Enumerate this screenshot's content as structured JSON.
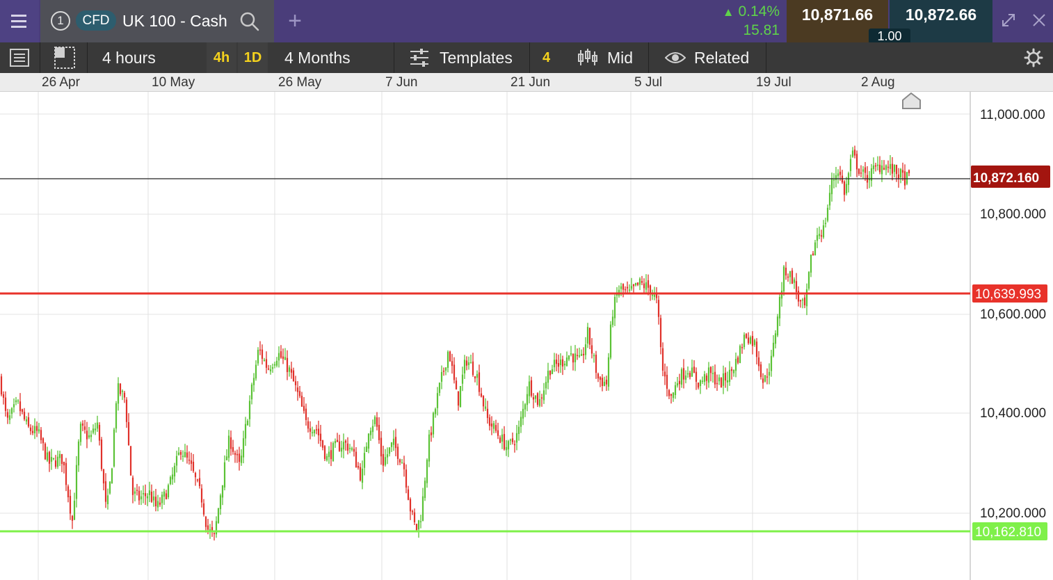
{
  "header": {
    "tab_number": "1",
    "product_badge": "CFD",
    "instrument_name": "UK 100 - Cash",
    "change_percent": "0.14%",
    "change_points": "15.81",
    "sell_price": "10,871.66",
    "buy_price": "10,872.66",
    "spread": "1.00"
  },
  "toolbar": {
    "interval_label": "4 hours",
    "interval_short_4h": "4h",
    "interval_short_1d": "1D",
    "range_label": "4 Months",
    "templates_label": "Templates",
    "templates_count": "4",
    "price_type_label": "Mid",
    "related_label": "Related"
  },
  "colors": {
    "up": "#5bc236",
    "down": "#e0312a",
    "resistance": "#e8322a",
    "support": "#7ff04a",
    "current_tag": "#a3150f"
  },
  "chart_data": {
    "type": "candlestick",
    "instrument": "UK 100 - Cash",
    "date_ticks": [
      "26 Apr",
      "10 May",
      "26 May",
      "7 Jun",
      "21 Jun",
      "5 Jul",
      "19 Jul",
      "2 Aug"
    ],
    "price_ticks": [
      "11,000.000",
      "10,800.000",
      "10,600.000",
      "10,400.000",
      "10,200.000"
    ],
    "ylim": [
      10102,
      11045
    ],
    "current_price": 10872.16,
    "current_price_label": "10,872.160",
    "resistance_level": 10639.993,
    "resistance_label": "10,639.993",
    "support_level": 10162.81,
    "support_label": "10,162.810",
    "close_path": [
      [
        0,
        10470
      ],
      [
        10,
        10380
      ],
      [
        25,
        10420
      ],
      [
        40,
        10370
      ],
      [
        55,
        10360
      ],
      [
        70,
        10300
      ],
      [
        90,
        10310
      ],
      [
        104,
        10185
      ],
      [
        115,
        10370
      ],
      [
        130,
        10350
      ],
      [
        140,
        10380
      ],
      [
        153,
        10200
      ],
      [
        160,
        10280
      ],
      [
        168,
        10450
      ],
      [
        180,
        10430
      ],
      [
        190,
        10240
      ],
      [
        200,
        10230
      ],
      [
        215,
        10240
      ],
      [
        225,
        10210
      ],
      [
        235,
        10230
      ],
      [
        245,
        10260
      ],
      [
        260,
        10330
      ],
      [
        275,
        10290
      ],
      [
        290,
        10230
      ],
      [
        298,
        10170
      ],
      [
        308,
        10150
      ],
      [
        318,
        10250
      ],
      [
        330,
        10350
      ],
      [
        345,
        10290
      ],
      [
        355,
        10390
      ],
      [
        372,
        10530
      ],
      [
        385,
        10490
      ],
      [
        400,
        10520
      ],
      [
        415,
        10490
      ],
      [
        430,
        10430
      ],
      [
        440,
        10380
      ],
      [
        455,
        10370
      ],
      [
        470,
        10310
      ],
      [
        480,
        10330
      ],
      [
        495,
        10340
      ],
      [
        505,
        10330
      ],
      [
        520,
        10270
      ],
      [
        530,
        10370
      ],
      [
        540,
        10390
      ],
      [
        550,
        10300
      ],
      [
        565,
        10340
      ],
      [
        580,
        10300
      ],
      [
        590,
        10210
      ],
      [
        598,
        10165
      ],
      [
        606,
        10200
      ],
      [
        615,
        10330
      ],
      [
        630,
        10440
      ],
      [
        645,
        10530
      ],
      [
        658,
        10420
      ],
      [
        670,
        10510
      ],
      [
        685,
        10480
      ],
      [
        700,
        10390
      ],
      [
        715,
        10360
      ],
      [
        730,
        10330
      ],
      [
        745,
        10360
      ],
      [
        760,
        10460
      ],
      [
        775,
        10420
      ],
      [
        790,
        10490
      ],
      [
        805,
        10500
      ],
      [
        820,
        10520
      ],
      [
        835,
        10500
      ],
      [
        845,
        10560
      ],
      [
        860,
        10470
      ],
      [
        872,
        10460
      ],
      [
        880,
        10600
      ],
      [
        890,
        10650
      ],
      [
        905,
        10640
      ],
      [
        920,
        10660
      ],
      [
        935,
        10650
      ],
      [
        945,
        10620
      ],
      [
        952,
        10490
      ],
      [
        965,
        10430
      ],
      [
        975,
        10470
      ],
      [
        990,
        10490
      ],
      [
        1005,
        10460
      ],
      [
        1020,
        10480
      ],
      [
        1035,
        10460
      ],
      [
        1050,
        10480
      ],
      [
        1060,
        10510
      ],
      [
        1072,
        10560
      ],
      [
        1085,
        10540
      ],
      [
        1098,
        10460
      ],
      [
        1110,
        10510
      ],
      [
        1118,
        10600
      ],
      [
        1128,
        10690
      ],
      [
        1140,
        10670
      ],
      [
        1150,
        10620
      ],
      [
        1158,
        10610
      ],
      [
        1165,
        10700
      ],
      [
        1175,
        10760
      ],
      [
        1185,
        10770
      ],
      [
        1195,
        10860
      ],
      [
        1205,
        10890
      ],
      [
        1215,
        10840
      ],
      [
        1225,
        10920
      ],
      [
        1235,
        10890
      ],
      [
        1245,
        10870
      ],
      [
        1258,
        10890
      ],
      [
        1270,
        10900
      ],
      [
        1280,
        10890
      ],
      [
        1292,
        10880
      ],
      [
        1300,
        10870
      ],
      [
        1308,
        10872
      ]
    ]
  }
}
